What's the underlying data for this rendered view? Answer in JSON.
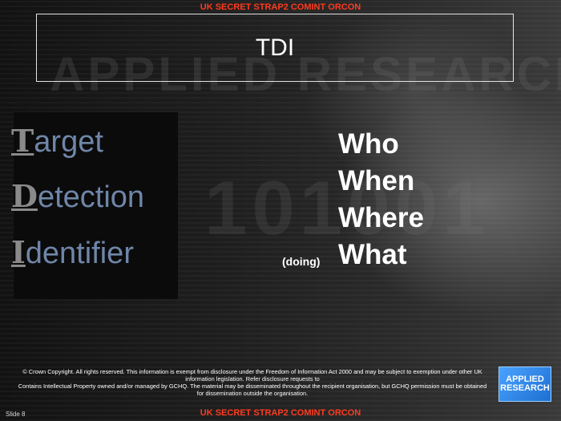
{
  "classification": "UK SECRET STRAP2 COMINT ORCON",
  "watermark": {
    "text": "APPLIED RESEARCH",
    "number": "101001"
  },
  "slide": {
    "title": "TDI",
    "number_label": "Slide 8"
  },
  "acronym": [
    {
      "letter": "T",
      "rest": "arget"
    },
    {
      "letter": "D",
      "rest": "etection"
    },
    {
      "letter": "I",
      "rest": "dentifier"
    }
  ],
  "questions": {
    "who": "Who",
    "when": "When",
    "where": "Where",
    "doing": "(doing)",
    "what": "What"
  },
  "footer": {
    "line1": "© Crown Copyright. All rights reserved. This information is exempt from disclosure under the Freedom of Information Act 2000 and may be subject to exemption under other UK information legislation. Refer disclosure requests to",
    "line2": "Contains Intellectual Property owned and/or managed by GCHQ. The material may be disseminated throughout the recipient organisation, but GCHQ permission must be obtained for dissemination outside the organisation."
  },
  "logo": {
    "line1": "APPLIED",
    "line2": "RESEARCH"
  },
  "colors": {
    "classification": "#ff3b1f",
    "acronym_text": "#6f86a8",
    "acronym_letter": "#8a8a8a"
  }
}
